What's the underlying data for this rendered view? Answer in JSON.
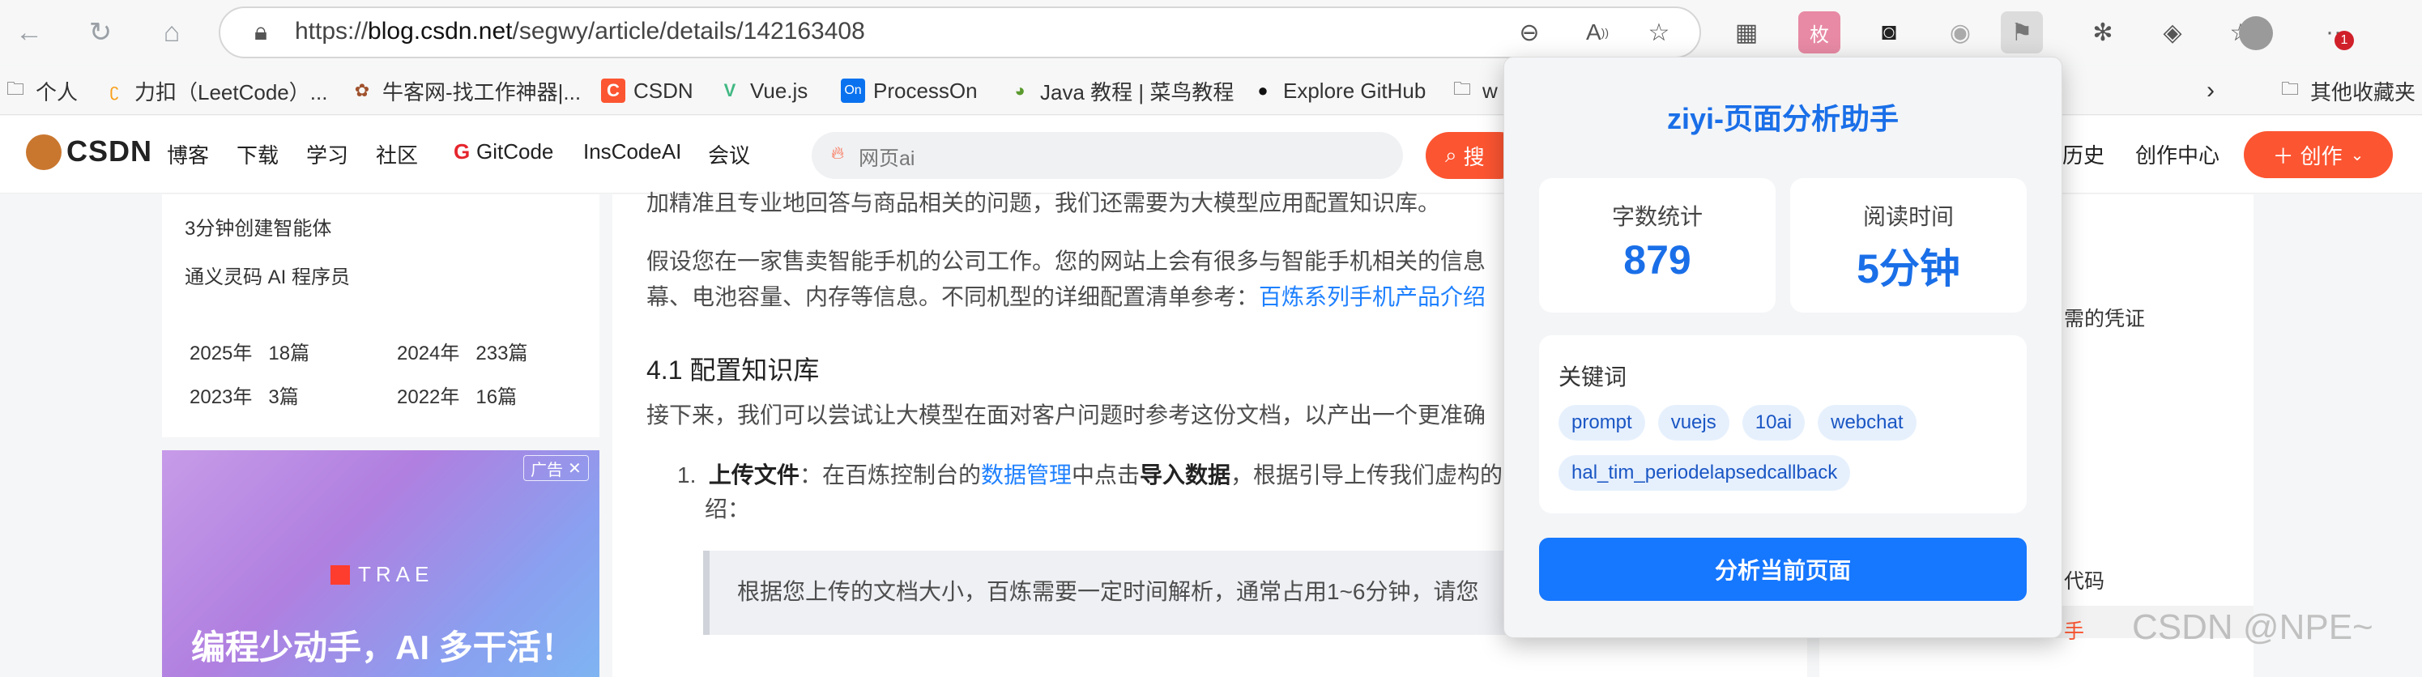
{
  "browser": {
    "url_prefix": "https://",
    "url_domain": "blog.csdn.net",
    "url_path": "/segwy/article/details/142163408",
    "notification_badge": "1"
  },
  "bookmarks": [
    {
      "label": "个人",
      "icon": "folder-icon"
    },
    {
      "label": "力扣（LeetCode）...",
      "icon": "leetcode-icon"
    },
    {
      "label": "牛客网-找工作神器|...",
      "icon": "nowcoder-icon"
    },
    {
      "label": "CSDN",
      "icon": "csdn-icon"
    },
    {
      "label": "Vue.js",
      "icon": "vue-icon"
    },
    {
      "label": "ProcessOn",
      "icon": "processon-icon"
    },
    {
      "label": "Java 教程 | 菜鸟教程",
      "icon": "runoob-icon"
    },
    {
      "label": "Explore GitHub",
      "icon": "github-icon"
    },
    {
      "label": "w",
      "icon": "folder-icon"
    },
    {
      "label": "其他收藏夹",
      "icon": "folder-icon"
    }
  ],
  "csdn": {
    "logo": "CSDN",
    "nav": [
      "博客",
      "下载",
      "学习",
      "社区",
      "GitCode",
      "InsCodeAI",
      "会议"
    ],
    "search_placeholder": "网页ai",
    "search_button": "搜",
    "right_nav": [
      "历史",
      "创作中心"
    ],
    "create_button": "创作"
  },
  "sidebar": {
    "links": [
      "3分钟创建智能体",
      "通义灵码 AI 程序员"
    ],
    "archive": [
      {
        "year": "2025年",
        "count": "18篇"
      },
      {
        "year": "2024年",
        "count": "233篇"
      },
      {
        "year": "2023年",
        "count": "3篇"
      },
      {
        "year": "2022年",
        "count": "16篇"
      }
    ],
    "ad_label": "广告",
    "ad_brand": "TRAE",
    "ad_headline": "编程少动手，AI 多干活！"
  },
  "article": {
    "p1": "加精准且专业地回答与商品相关的问题，我们还需要为大模型应用配置知识库。",
    "p2a": "假设您在一家售卖智能手机的公司工作。您的网站上会有很多与智能手机相关的信息",
    "p2b": "幕、电池容量、内存等信息。不同机型的详细配置清单参考：",
    "p2_link": "百炼系列手机产品介绍",
    "h3": "4.1 配置知识库",
    "p3": "接下来，我们可以尝试让大模型在面对客户问题时参考这份文档，以产出一个更准确",
    "li_num": "1.",
    "li_bold": "上传文件",
    "li_a": "：在百炼控制台的",
    "li_link": "数据管理",
    "li_b": "中点击",
    "li_bold2": "导入数据",
    "li_c": "，根据引导上传我们虚构的",
    "li_d": "绍：",
    "quote": "根据您上传的文档大小，百炼需要一定时间解析，通常占用1~6分钟，请您"
  },
  "right_panel": {
    "item1": "需的凭证",
    "item2": "代码",
    "item3": "手"
  },
  "watermark": "CSDN @NPE~",
  "popup": {
    "title": "ziyi-页面分析助手",
    "word_count_label": "字数统计",
    "word_count_value": "879",
    "read_time_label": "阅读时间",
    "read_time_value": "5分钟",
    "keywords_label": "关键词",
    "keywords": [
      "prompt",
      "vuejs",
      "10ai",
      "webchat",
      "hal_tim_periodelapsedcallback"
    ],
    "analyze_button": "分析当前页面"
  }
}
